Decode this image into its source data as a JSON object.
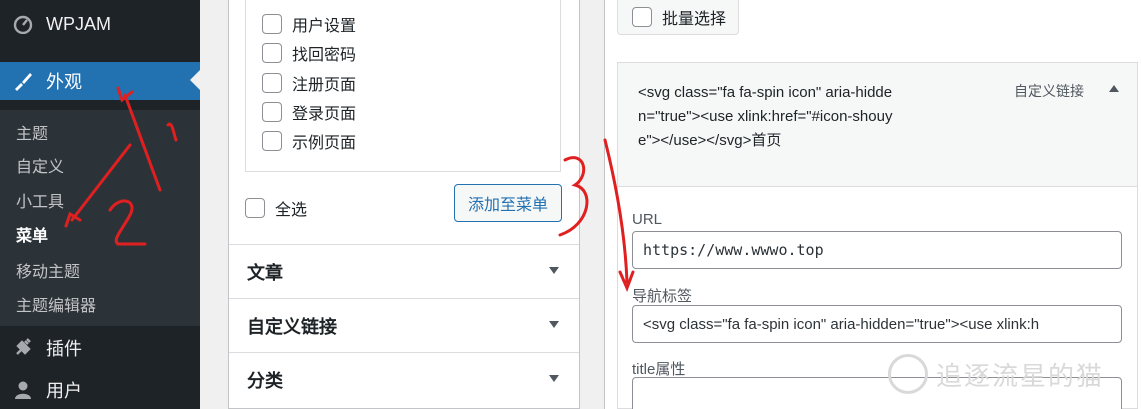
{
  "sidebar": {
    "site": "WPJAM",
    "appearance": "外观",
    "submenu": [
      "主题",
      "自定义",
      "小工具",
      "菜单",
      "移动主题",
      "主题编辑器"
    ],
    "plugins": "插件",
    "users": "用户"
  },
  "pages": {
    "items": [
      "用户设置",
      "找回密码",
      "注册页面",
      "登录页面",
      "示例页面"
    ],
    "select_all": "全选",
    "add_button": "添加至菜单"
  },
  "accordions": [
    "文章",
    "自定义链接",
    "分类"
  ],
  "menu_item": {
    "bulk_select": "批量选择",
    "title": "<svg class=\"fa fa-spin icon\" aria-hidden=\"true\"><use xlink:href=\"#icon-shouye\"></use></svg>首页",
    "type": "自定义链接",
    "url_label": "URL",
    "url_value": "https://www.wwwo.top",
    "nav_label": "导航标签",
    "nav_value": "<svg class=\"fa fa-spin icon\" aria-hidden=\"true\"><use xlink:h",
    "title_attr_label": "title属性",
    "title_attr_value": ""
  },
  "annotations": [
    "1",
    "2",
    "3"
  ],
  "watermark": "追逐流星的猫",
  "colors": {
    "sidebar": "#1d2327",
    "active": "#2271b1",
    "annotation": "#e02020"
  }
}
